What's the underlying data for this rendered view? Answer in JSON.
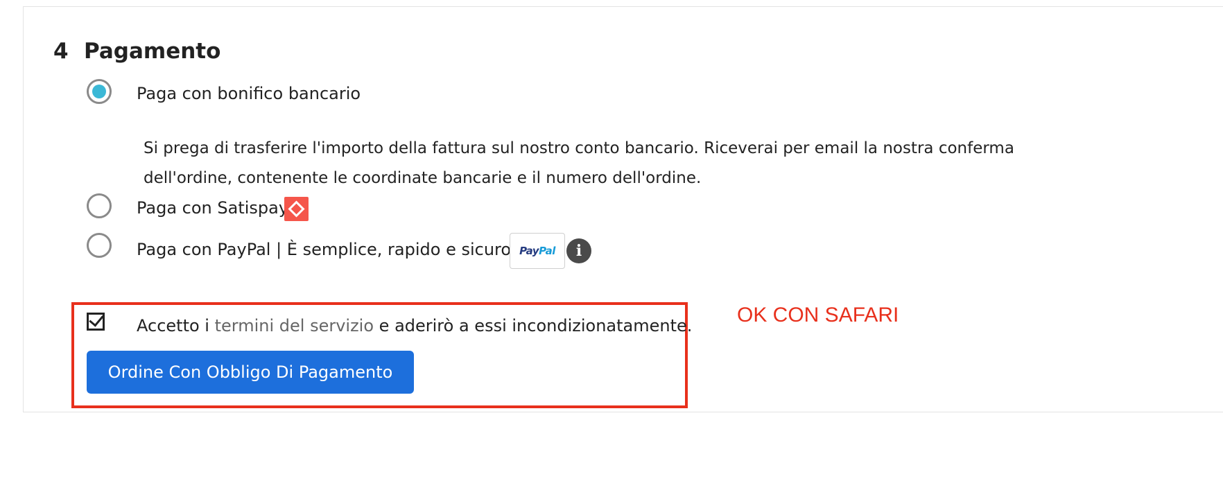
{
  "step": {
    "number": "4",
    "title": "Pagamento"
  },
  "payment_options": [
    {
      "label": "Paga con bonifico bancario",
      "selected": true,
      "description": "Si prega di trasferire l'importo della fattura sul nostro conto bancario. Riceverai per email la nostra conferma dell'ordine, contenente le coordinate bancarie e il numero dell'ordine."
    },
    {
      "label": "Paga con Satispay",
      "selected": false,
      "icon": "satispay-logo-icon"
    },
    {
      "label": "Paga con PayPal | È semplice, rapido e sicuro",
      "selected": false,
      "badge_pay": "Pay",
      "badge_pal": "Pal",
      "info_icon": "info-icon"
    }
  ],
  "terms": {
    "checked": true,
    "prefix": "Accetto i",
    "link": "termini del servizio",
    "suffix": "e aderirò a essi incondizionatamente."
  },
  "order_button": {
    "label": "Ordine Con Obbligo Di Pagamento"
  },
  "annotation": {
    "text": "OK CON SAFARI"
  },
  "colors": {
    "radio_selected": "#3bb8d6",
    "button": "#1d6fdc",
    "annotation": "#e8301c",
    "satispay": "#f5564b"
  }
}
